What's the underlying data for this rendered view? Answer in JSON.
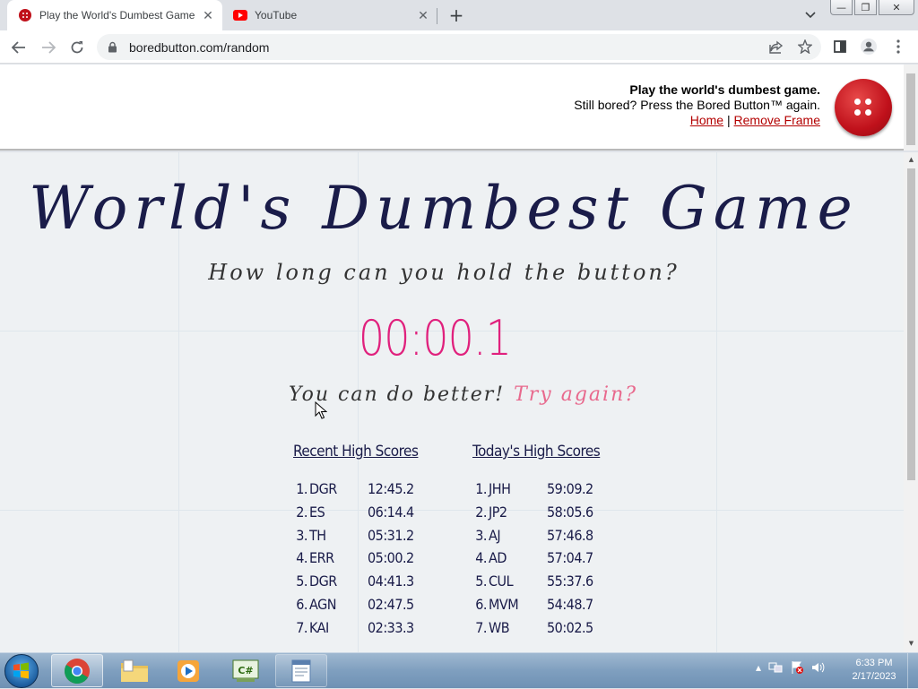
{
  "browser": {
    "tabs": [
      {
        "title": "Play the World's Dumbest Game",
        "icon": "bored-button-favicon",
        "active": true
      },
      {
        "title": "YouTube",
        "icon": "youtube-icon",
        "active": false
      }
    ],
    "url": "boredbutton.com/random",
    "window_buttons": {
      "minimize": "—",
      "restore": "❐",
      "close": "✕"
    }
  },
  "frame_header": {
    "headline": "Play the world's dumbest game.",
    "subline": "Still bored? Press the Bored Button™ again.",
    "home_link": "Home",
    "separator": "|",
    "remove_frame_link": "Remove Frame",
    "button_color": "#c0111b"
  },
  "game": {
    "title": "World's Dumbest Game",
    "subtitle": "How long can you hold the button?",
    "timer": "00:00.1",
    "feedback": "You can do better!",
    "try_again": "Try again?",
    "recent_scores": {
      "heading": "Recent High Scores",
      "rows": [
        {
          "rank": "1.",
          "name": "DGR",
          "time": "12:45.2"
        },
        {
          "rank": "2.",
          "name": "ES",
          "time": "06:14.4"
        },
        {
          "rank": "3.",
          "name": "TH",
          "time": "05:31.2"
        },
        {
          "rank": "4.",
          "name": "ERR",
          "time": "05:00.2"
        },
        {
          "rank": "5.",
          "name": "DGR",
          "time": "04:41.3"
        },
        {
          "rank": "6.",
          "name": "AGN",
          "time": "02:47.5"
        },
        {
          "rank": "7.",
          "name": "KAI",
          "time": "02:33.3"
        }
      ]
    },
    "today_scores": {
      "heading": "Today's High Scores",
      "rows": [
        {
          "rank": "1.",
          "name": "JHH",
          "time": "59:09.2"
        },
        {
          "rank": "2.",
          "name": "JP2",
          "time": "58:05.6"
        },
        {
          "rank": "3.",
          "name": "AJ",
          "time": "57:46.8"
        },
        {
          "rank": "4.",
          "name": "AD",
          "time": "57:04.7"
        },
        {
          "rank": "5.",
          "name": "CUL",
          "time": "55:37.6"
        },
        {
          "rank": "6.",
          "name": "MVM",
          "time": "54:48.7"
        },
        {
          "rank": "7.",
          "name": "WB",
          "time": "50:02.5"
        }
      ]
    },
    "colors": {
      "title": "#1a1c49",
      "timer": "#e0217d",
      "try_again": "#e8698d"
    }
  },
  "taskbar": {
    "items": [
      "start-orb",
      "chrome-icon",
      "file-explorer-icon",
      "media-player-icon",
      "csharp-app-icon",
      "notepad-app-icon"
    ],
    "clock_time": "6:33 PM",
    "clock_date": "2/17/2023"
  }
}
